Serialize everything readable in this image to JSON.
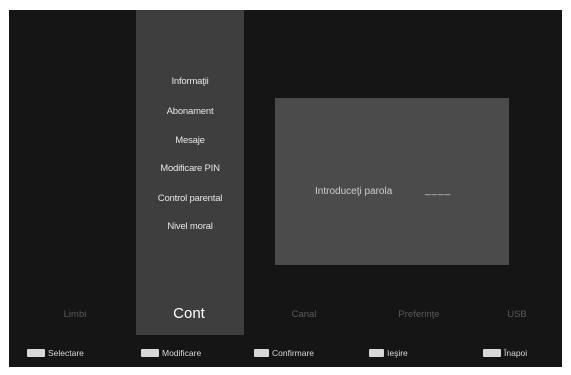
{
  "menu": {
    "items": [
      {
        "label": "Informaţii"
      },
      {
        "label": "Abonament"
      },
      {
        "label": "Mesaje"
      },
      {
        "label": "Modificare PIN"
      },
      {
        "label": "Control parental"
      },
      {
        "label": "Nivel moral"
      }
    ]
  },
  "dialog": {
    "prompt": "Introduceţi parola",
    "pin_value": "____"
  },
  "tabs": [
    {
      "label": "Limbi",
      "active": false
    },
    {
      "label": "Cont",
      "active": true
    },
    {
      "label": "Canal",
      "active": false
    },
    {
      "label": "Preferinţe",
      "active": false
    },
    {
      "label": "USB",
      "active": false
    }
  ],
  "hints": [
    {
      "key_icon": "up-down-keys-icon",
      "label": "Selectare"
    },
    {
      "key_icon": "left-right-keys-icon",
      "label": "Modificare"
    },
    {
      "key_icon": "ok-key-icon",
      "label": "Confirmare"
    },
    {
      "key_icon": "exit-key-icon",
      "label": "Ieşire"
    },
    {
      "key_icon": "back-key-icon",
      "label": "Înapoi"
    }
  ],
  "colors": {
    "background": "#151515",
    "menu_column": "#3e3e3e",
    "dialog": "#4b4b4b"
  }
}
